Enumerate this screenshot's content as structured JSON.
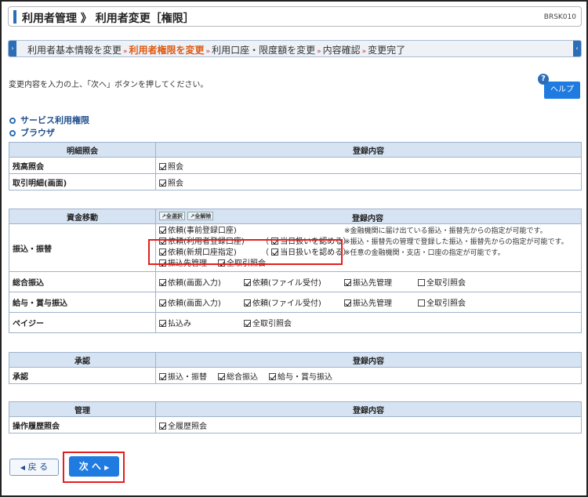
{
  "header": {
    "title": "利用者管理 》 利用者変更［権限］",
    "screen_id": "BRSK010"
  },
  "steps": {
    "items": [
      "利用者基本情報を変更",
      "利用者権限を変更",
      "利用口座・限度額を変更",
      "内容確認",
      "変更完了"
    ],
    "current_index": 1,
    "separator": "»"
  },
  "instruction": "変更内容を入力の上、「次へ」ボタンを押してください。",
  "help": {
    "icon_label": "?",
    "label": "ヘルプ"
  },
  "sections": {
    "service": "サービス利用権限",
    "browser": "ブラウザ"
  },
  "meisai": {
    "header_left": "明細照会",
    "header_right": "登録内容",
    "rows": [
      {
        "label": "残高照会",
        "options": [
          {
            "label": "照会",
            "checked": true
          }
        ]
      },
      {
        "label": "取引明細(画面)",
        "options": [
          {
            "label": "照会",
            "checked": true
          }
        ]
      }
    ]
  },
  "shikin": {
    "header_left": "資金移動",
    "select_all": "全選択",
    "clear_all": "全解除",
    "header_right": "登録内容",
    "furikomi": {
      "label": "振込・振替",
      "lines": [
        {
          "a": "依頼(事前登録口座)",
          "a_checked": true,
          "note": "※金融機関に届け出ている振込・振替先からの指定が可能です。"
        },
        {
          "a": "依頼(利用者登録口座)",
          "a_checked": true,
          "b": "当日扱いを認める",
          "b_checked": true,
          "note": "※振込・振替先の管理で登録した振込・振替先からの指定が可能です。"
        },
        {
          "a": "依頼(新規口座指定)",
          "a_checked": true,
          "b": "当日扱いを認める",
          "b_checked": true,
          "note": "※任意の金融機関・支店・口座の指定が可能です。"
        }
      ],
      "extra": [
        {
          "label": "振込先管理",
          "checked": true
        },
        {
          "label": "全取引照会",
          "checked": true
        }
      ]
    },
    "rows": [
      {
        "label": "総合振込",
        "options": [
          {
            "label": "依頼(画面入力)",
            "checked": true
          },
          {
            "label": "依頼(ファイル受付)",
            "checked": true
          },
          {
            "label": "振込先管理",
            "checked": true
          },
          {
            "label": "全取引照会",
            "checked": false
          }
        ]
      },
      {
        "label": "給与・賞与振込",
        "options": [
          {
            "label": "依頼(画面入力)",
            "checked": true
          },
          {
            "label": "依頼(ファイル受付)",
            "checked": true
          },
          {
            "label": "振込先管理",
            "checked": true
          },
          {
            "label": "全取引照会",
            "checked": false
          }
        ]
      },
      {
        "label": "ペイジー",
        "options": [
          {
            "label": "払込み",
            "checked": true
          },
          {
            "label": "全取引照会",
            "checked": true
          }
        ]
      }
    ]
  },
  "shonin": {
    "header_left": "承認",
    "header_right": "登録内容",
    "rows": [
      {
        "label": "承認",
        "options": [
          {
            "label": "振込・振替",
            "checked": true
          },
          {
            "label": "総合振込",
            "checked": true
          },
          {
            "label": "給与・賞与振込",
            "checked": true
          }
        ]
      }
    ]
  },
  "kanri": {
    "header_left": "管理",
    "header_right": "登録内容",
    "rows": [
      {
        "label": "操作履歴照会",
        "options": [
          {
            "label": "全履歴照会",
            "checked": true
          }
        ]
      }
    ]
  },
  "buttons": {
    "back": "戻 る",
    "next": "次 へ"
  },
  "colors": {
    "accent": "#2c6db8",
    "current_step": "#e05a12",
    "highlight_box": "#e41e1e",
    "table_header": "#d6e3f2",
    "button_blue": "#1f7be0"
  }
}
